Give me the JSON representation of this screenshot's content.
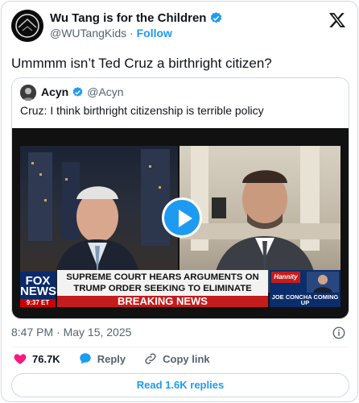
{
  "author": {
    "display_name": "Wu Tang is for the Children",
    "handle": "@WUTangKids",
    "separator": "·",
    "follow_label": "Follow"
  },
  "tweet": {
    "text": "Ummmm isn’t Ted Cruz a birthright citizen?"
  },
  "quote": {
    "display_name": "Acyn",
    "handle": "@Acyn",
    "text": "Cruz: I think birthright citizenship is terrible policy"
  },
  "video": {
    "network_logo": "FOX NEWS",
    "network_clock": "9:37 ET",
    "headline": "SUPREME COURT HEARS ARGUMENTS ON TRUMP ORDER SEEKING TO ELIMINATE BIRTHRIGHT CITIZENSHIP",
    "breaking": "BREAKING NEWS",
    "show_logo": "Hannity",
    "up_next": "JOE CONCHA COMING UP"
  },
  "meta": {
    "timestamp": "8:47 PM · May 15, 2025"
  },
  "actions": {
    "like_count": "76.7K",
    "reply_label": "Reply",
    "copy_label": "Copy link"
  },
  "read_replies_label": "Read 1.6K replies",
  "colors": {
    "accent": "#1d9bf0",
    "like": "#f91880",
    "muted": "#536471",
    "border": "#cfd9de"
  },
  "icons": [
    "x-logo-icon",
    "verified-badge-icon",
    "play-icon",
    "info-icon",
    "heart-icon",
    "reply-bubble-icon",
    "link-icon"
  ]
}
